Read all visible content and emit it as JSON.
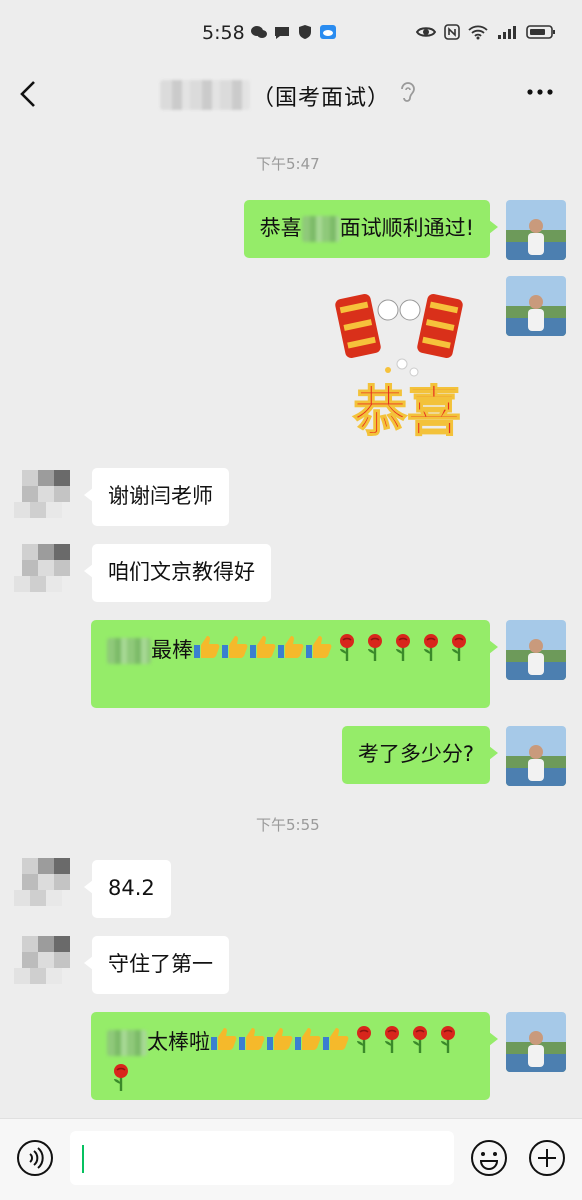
{
  "status_bar": {
    "time": "5:58"
  },
  "chat": {
    "title": "（国考面试）",
    "timestamps": [
      "下午5:47",
      "下午5:55"
    ],
    "messages": [
      {
        "id": "m1",
        "from": "self",
        "text_pre": "恭喜",
        "text_post": "面试顺利通过!"
      },
      {
        "id": "m2",
        "from": "self",
        "type": "sticker",
        "sticker_text": "恭喜"
      },
      {
        "id": "m3",
        "from": "other",
        "text": "谢谢闫老师"
      },
      {
        "id": "m4",
        "from": "other",
        "text": "咱们文京教得好"
      },
      {
        "id": "m5",
        "from": "self",
        "text_post": "最棒",
        "emojis": [
          "thumbs-up",
          "thumbs-up",
          "thumbs-up",
          "thumbs-up",
          "thumbs-up",
          "rose",
          "rose",
          "rose",
          "rose",
          "rose"
        ]
      },
      {
        "id": "m6",
        "from": "self",
        "text": "考了多少分?"
      },
      {
        "id": "m7",
        "from": "other",
        "text": "84.2"
      },
      {
        "id": "m8",
        "from": "other",
        "text": "守住了第一"
      },
      {
        "id": "m9",
        "from": "self",
        "text_post": "太棒啦",
        "emojis": [
          "thumbs-up",
          "thumbs-up",
          "thumbs-up",
          "thumbs-up",
          "thumbs-up",
          "rose",
          "rose",
          "rose",
          "rose",
          "rose"
        ]
      }
    ]
  },
  "input": {
    "placeholder": ""
  },
  "colors": {
    "self_bubble": "#95ec69",
    "other_bubble": "#ffffff",
    "background": "#ededed",
    "accent": "#07c160"
  }
}
